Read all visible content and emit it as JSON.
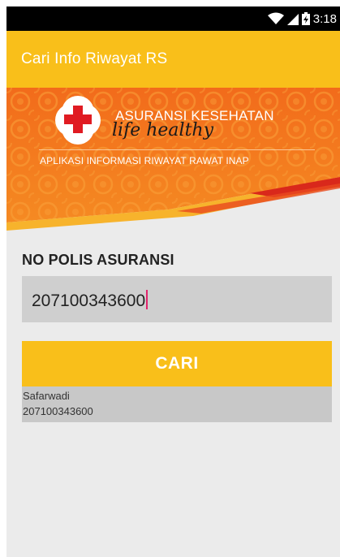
{
  "status_bar": {
    "time": "3:18",
    "icons": [
      "wifi-icon",
      "signal-icon",
      "battery-icon"
    ]
  },
  "app_bar": {
    "title": "Cari Info Riwayat RS"
  },
  "banner": {
    "brand_name": "ASURANSI KESEHATAN",
    "tagline": "life healthy",
    "subtitle": "APLIKASI INFORMASI RIWAYAT RAWAT INAP",
    "logo": "red-cross-logo"
  },
  "form": {
    "label": "NO POLIS ASURANSI",
    "input_value": "207100343600",
    "button_label": "CARI"
  },
  "results": [
    {
      "name": "Safarwadi",
      "polis": "207100343600"
    }
  ],
  "colors": {
    "accent": "#f9bf1a",
    "banner_orange": "#f47a1c",
    "banner_red": "#d9281b",
    "input_bg": "#cfcfcf",
    "result_bg": "#c8c8c8",
    "screen_bg": "#ebebeb",
    "caret": "#e0246c"
  }
}
